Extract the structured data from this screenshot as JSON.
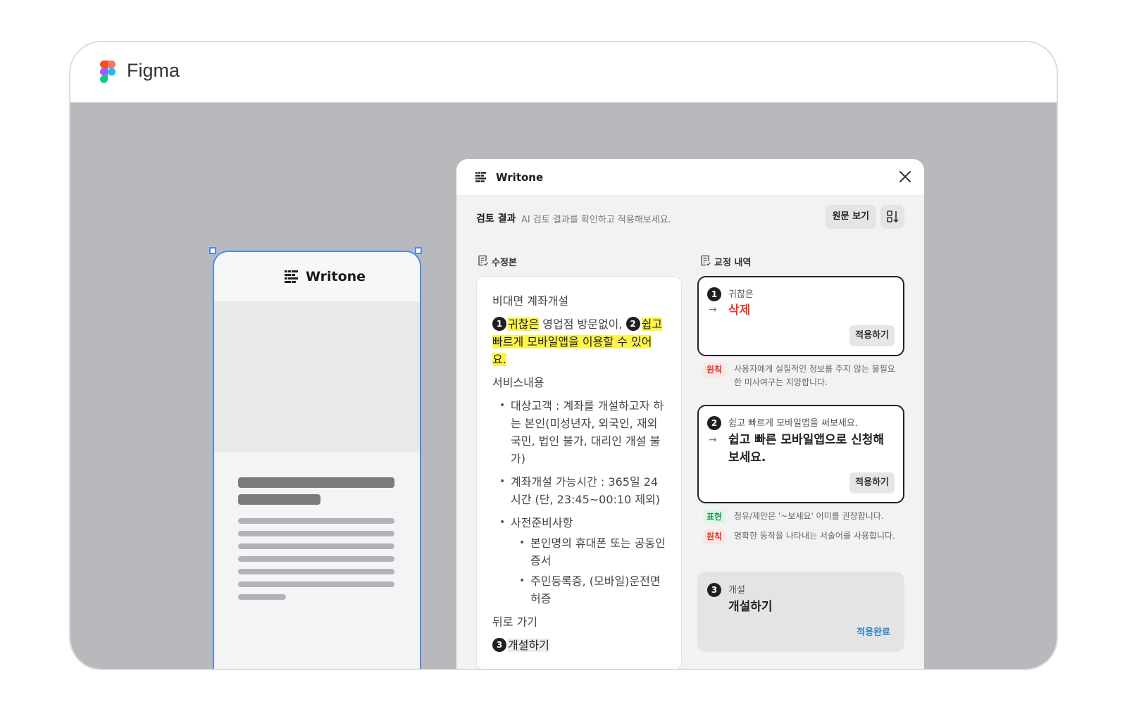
{
  "app": {
    "name": "Figma"
  },
  "phone": {
    "title": "Writone"
  },
  "plugin": {
    "title": "Writone",
    "subheader": {
      "title": "검토 결과",
      "description": "AI 검토 결과를 확인하고 적용해보세요.",
      "original_button": "원문 보기"
    },
    "revised_label": "수정본",
    "history_label": "교정 내역",
    "revised": {
      "heading": "비대면 계좌개설",
      "line1_hl1": "귀찮은",
      "line1_mid": " 영업점 방문없이, ",
      "line1_hl2": "쉽고 빠르게 모바일앱을 이용할 수 있어요.",
      "service": "서비스내용",
      "bullets": [
        "대상고객 : 계좌를 개설하고자 하는 본인(미성년자, 외국인, 재외국민, 법인 불가, 대리인 개설 불가)",
        "계좌개설 가능시간 : 365일 24시간 (단, 23:45~00:10 제외)",
        "사전준비사항"
      ],
      "sub_bullets": [
        "본인명의 휴대폰 또는 공동인증서",
        "주민등록증, (모바일)운전면허증"
      ],
      "back": "뒤로 가기",
      "open": "개설하기"
    },
    "corrections": [
      {
        "num": "1",
        "original": "귀찮은",
        "fix": "삭제",
        "button": "적용하기"
      },
      {
        "num": "2",
        "original": "쉽고 빠르게 모바일앱을 써보세요.",
        "fix": "쉽고 빠른 모바일앱으로 신청해 보세요.",
        "button": "적용하기"
      },
      {
        "num": "3",
        "original": "개설",
        "fix": "개설하기",
        "button": "적용완료"
      }
    ],
    "rules": [
      {
        "tag": "원칙",
        "text": "사용자에게 실질적인 정보를 주지 않는 불필요한 미사여구는 지양합니다."
      },
      {
        "tag": "표현",
        "text": "청유/제안은 '~보세요' 어미를 권장합니다."
      },
      {
        "tag": "원칙",
        "text": "명확한 동작을 나타내는 서술어를 사용합니다."
      }
    ]
  }
}
